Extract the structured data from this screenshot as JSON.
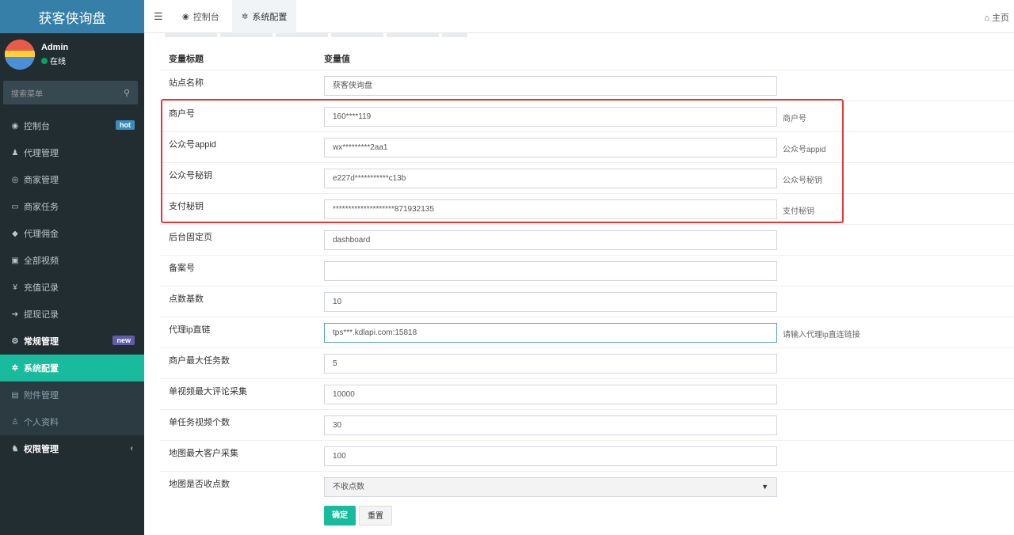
{
  "app": {
    "logo_title": "获客侠询盘"
  },
  "user": {
    "name": "Admin",
    "status": "在线"
  },
  "search": {
    "placeholder": "搜索菜单"
  },
  "sidebar": {
    "items": [
      {
        "label": "控制台",
        "icon": "dashboard-icon",
        "glyph": "◉",
        "badge": "hot"
      },
      {
        "label": "代理管理",
        "icon": "users-icon",
        "glyph": "♟"
      },
      {
        "label": "商家管理",
        "icon": "eye-icon",
        "glyph": "◎"
      },
      {
        "label": "商家任务",
        "icon": "keyboard-icon",
        "glyph": "▭"
      },
      {
        "label": "代理佣金",
        "icon": "diamond-icon",
        "glyph": "◆"
      },
      {
        "label": "全部视频",
        "icon": "file-video-icon",
        "glyph": "▣"
      },
      {
        "label": "充值记录",
        "icon": "yen-icon",
        "glyph": "¥"
      },
      {
        "label": "提现记录",
        "icon": "sign-in-icon",
        "glyph": "➔"
      },
      {
        "label": "常规管理",
        "icon": "cogs-icon",
        "glyph": "⚙",
        "badge": "new"
      },
      {
        "label": "系统配置",
        "icon": "cog-icon",
        "glyph": "✲"
      },
      {
        "label": "附件管理",
        "icon": "file-image-icon",
        "glyph": "▤"
      },
      {
        "label": "个人资料",
        "icon": "user-icon",
        "glyph": "♙"
      },
      {
        "label": "权限管理",
        "icon": "group-icon",
        "glyph": "♞",
        "chevron": "‹"
      }
    ]
  },
  "topbar": {
    "tabs": [
      {
        "label": "控制台",
        "glyph": "◉"
      },
      {
        "label": "系统配置",
        "glyph": "✲"
      }
    ],
    "home_label": "主页",
    "home_glyph": "⌂"
  },
  "table": {
    "header_title": "变量标题",
    "header_value": "变量值",
    "rows": [
      {
        "label": "站点名称",
        "value": "获客侠询盘",
        "hint": ""
      },
      {
        "label": "商户号",
        "value": "160****119",
        "hint": "商户号"
      },
      {
        "label": "公众号appid",
        "value": "wx*********2aa1",
        "hint": "公众号appid"
      },
      {
        "label": "公众号秘钥",
        "value": "e227d***********c13b",
        "hint": "公众号秘钥"
      },
      {
        "label": "支付秘钥",
        "value": "********************871932135",
        "hint": "支付秘钥"
      },
      {
        "label": "后台固定页",
        "value": "dashboard",
        "hint": ""
      },
      {
        "label": "备案号",
        "value": "",
        "hint": ""
      },
      {
        "label": "点数基数",
        "value": "10",
        "hint": ""
      },
      {
        "label": "代理ip直链",
        "value": "tps***.kdlapi.com:15818",
        "hint": "请输入代理ip直连链接"
      },
      {
        "label": "商户最大任务数",
        "value": "5",
        "hint": ""
      },
      {
        "label": "单视频最大评论采集",
        "value": "10000",
        "hint": ""
      },
      {
        "label": "单任务视频个数",
        "value": "30",
        "hint": ""
      },
      {
        "label": "地图最大客户采集",
        "value": "100",
        "hint": ""
      },
      {
        "label": "地图是否收点数",
        "value": "不收点数",
        "hint": ""
      }
    ]
  },
  "buttons": {
    "ok": "确定",
    "reset": "重置"
  },
  "colors": {
    "sidebar_bg": "#222d32",
    "logo_bg": "#367fa9",
    "accent": "#18bc9c",
    "highlight_border": "#e53935"
  }
}
